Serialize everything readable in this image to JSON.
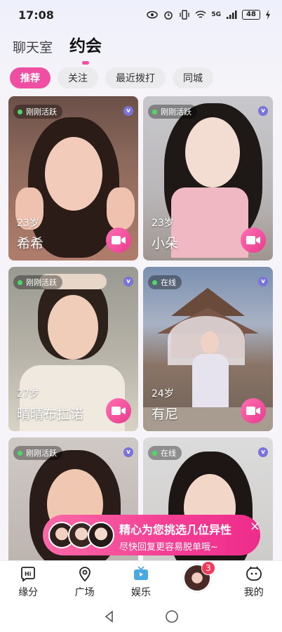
{
  "status": {
    "time": "17:08",
    "battery": "48",
    "network": "5G"
  },
  "header": {
    "tabs": [
      {
        "label": "聊天室"
      },
      {
        "label": "约会"
      }
    ]
  },
  "filters": [
    {
      "label": "推荐"
    },
    {
      "label": "关注"
    },
    {
      "label": "最近拨打"
    },
    {
      "label": "同城"
    }
  ],
  "cards": [
    {
      "status": "刚刚活跃",
      "age": "23岁",
      "name": "希希"
    },
    {
      "status": "刚刚活跃",
      "age": "23岁",
      "name": "小朵"
    },
    {
      "status": "刚刚活跃",
      "age": "27岁",
      "name": "晴晴布拉诺"
    },
    {
      "status": "在线",
      "age": "24岁",
      "name": "有尼"
    },
    {
      "status": "刚刚活跃"
    },
    {
      "status": "在线"
    }
  ],
  "popup": {
    "line1": "精心为您挑选几位异性",
    "line2": "尽快回复更容易脱单哦~",
    "close": "×"
  },
  "nav": [
    {
      "label": "缘分",
      "icon": "hi-icon"
    },
    {
      "label": "广场",
      "icon": "location-icon"
    },
    {
      "label": "娱乐",
      "icon": "tv-icon"
    },
    {
      "label": "",
      "icon": "avatar"
    },
    {
      "label": "我的",
      "icon": "face-icon"
    }
  ],
  "nav_badge": "3",
  "colors": {
    "accent": "#ee4fa3",
    "online_dot": "#4cd964",
    "badge": "#f23a5a"
  }
}
